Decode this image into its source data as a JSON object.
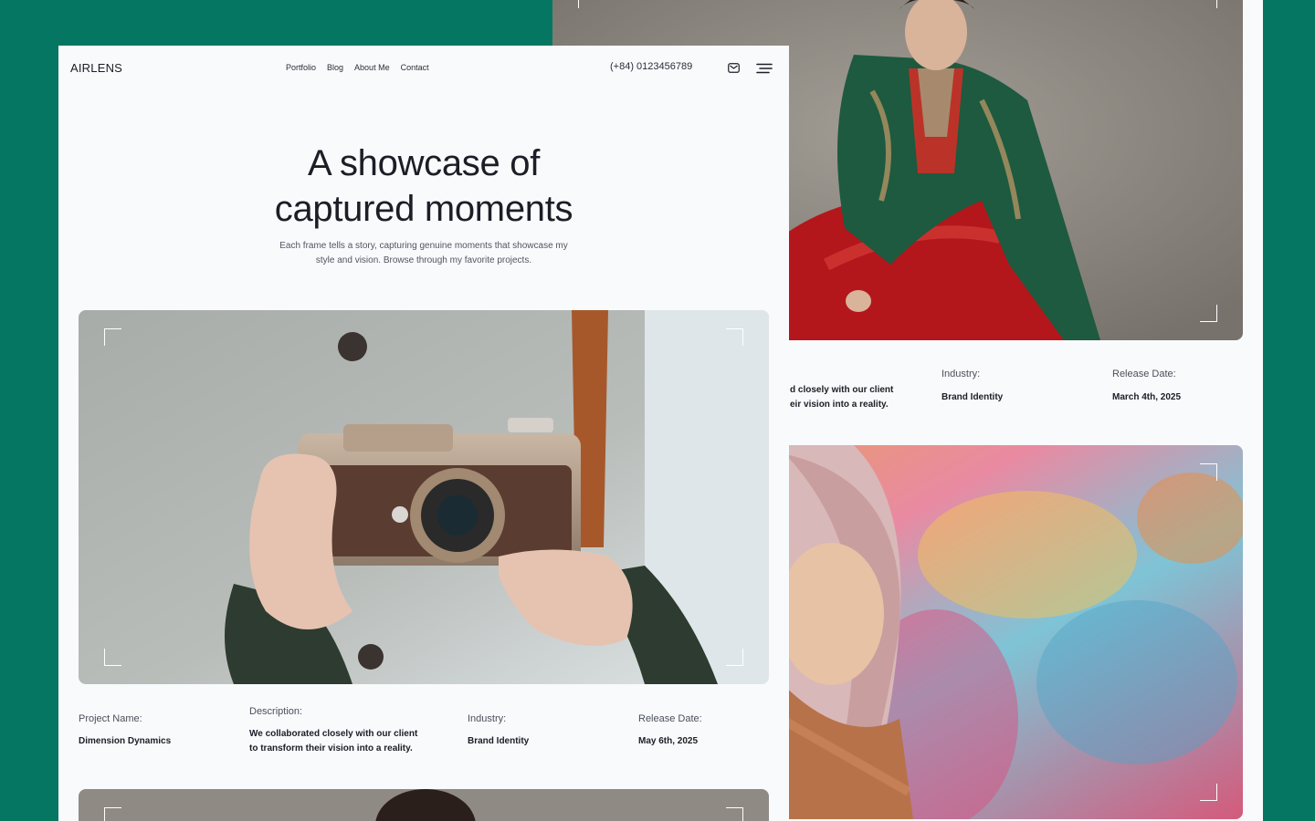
{
  "brand": "AIRLENS",
  "nav": {
    "links": [
      "Portfolio",
      "Blog",
      "About Me",
      "Contact"
    ]
  },
  "header": {
    "phone": "(+84) 0123456789",
    "icons": [
      "mail-icon",
      "menu-icon"
    ]
  },
  "hero": {
    "title_line1": "A showcase of",
    "title_line2": "captured moments",
    "subtitle_line1": "Each frame tells a story, capturing genuine moments that showcase my",
    "subtitle_line2": "style and vision. Browse through my favorite projects."
  },
  "project": {
    "name_label": "Project Name:",
    "name": "Dimension Dynamics",
    "description_label": "Description:",
    "description_line1": "We collaborated closely with our client",
    "description_line2": "to transform their vision into a reality.",
    "industry_label": "Industry:",
    "industry": "Brand Identity",
    "release_label": "Release Date:",
    "release": "May 6th, 2025"
  },
  "back_project": {
    "description_line1": "d closely with our client",
    "description_line2": "eir vision into a reality.",
    "industry_label": "Industry:",
    "industry": "Brand Identity",
    "release_label": "Release Date:",
    "release": "March 4th, 2025"
  },
  "colors": {
    "background": "#047662",
    "panel": "#f8fafc",
    "text": "#1b1e26"
  }
}
